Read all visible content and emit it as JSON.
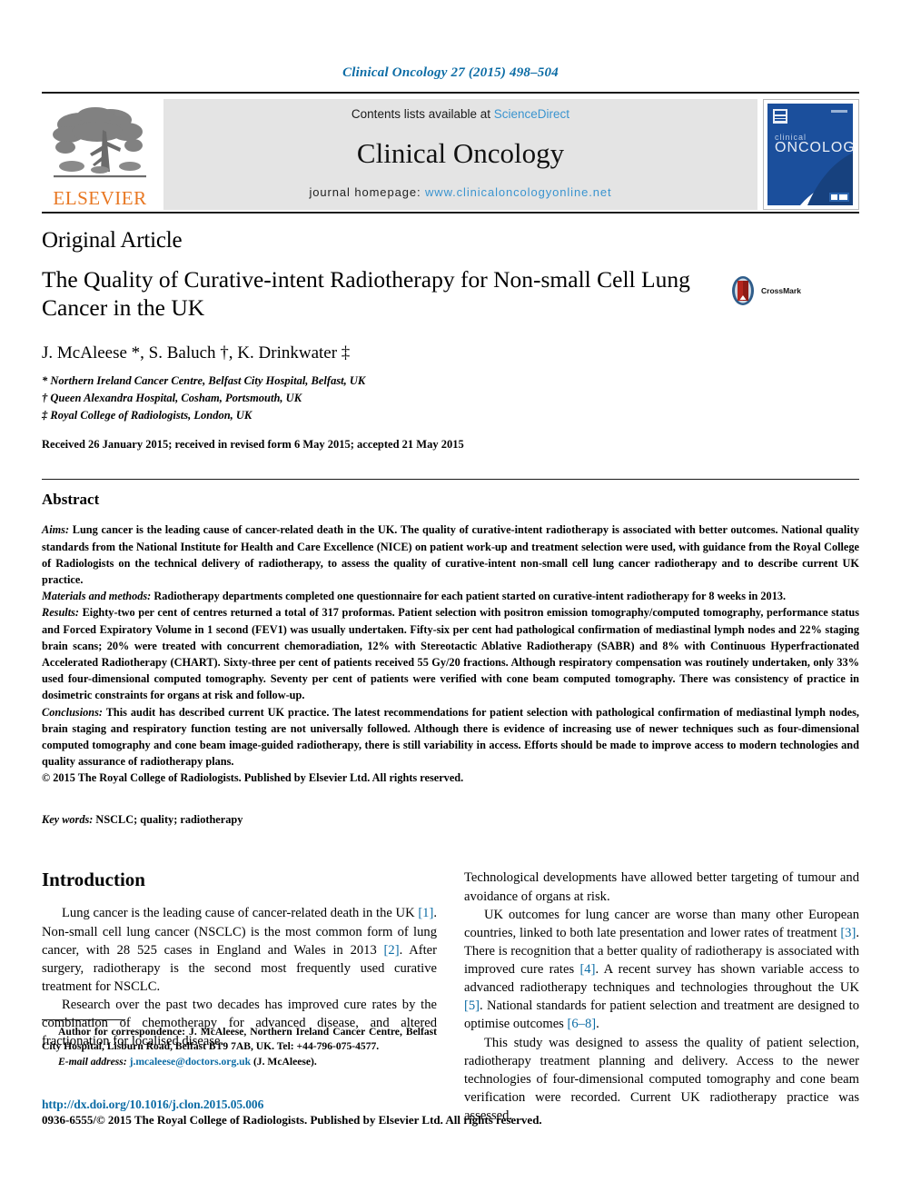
{
  "running_head": "Clinical Oncology 27 (2015) 498–504",
  "masthead": {
    "publisher_logo_word": "ELSEVIER",
    "contents_prefix": "Contents lists available at",
    "contents_link": "ScienceDirect",
    "journal_name": "Clinical Oncology",
    "homepage_prefix": "journal homepage:",
    "homepage_url": "www.clinicaloncologyonline.net",
    "cover_title_small": "clinical",
    "cover_title_large": "ONCOLOGY"
  },
  "article": {
    "type": "Original Article",
    "title": "The Quality of Curative-intent Radiotherapy for Non-small Cell Lung Cancer in the UK",
    "crossmark_label": "CrossMark",
    "authors": "J. McAleese *, S. Baluch †, K. Drinkwater ‡",
    "affiliations": [
      "* Northern Ireland Cancer Centre, Belfast City Hospital, Belfast, UK",
      "† Queen Alexandra Hospital, Cosham, Portsmouth, UK",
      "‡ Royal College of Radiologists, London, UK"
    ],
    "history": "Received 26 January 2015; received in revised form 6 May 2015; accepted 21 May 2015"
  },
  "abstract": {
    "heading": "Abstract",
    "aims_label": "Aims:",
    "aims_text": " Lung cancer is the leading cause of cancer-related death in the UK. The quality of curative-intent radiotherapy is associated with better outcomes. National quality standards from the National Institute for Health and Care Excellence (NICE) on patient work-up and treatment selection were used, with guidance from the Royal College of Radiologists on the technical delivery of radiotherapy, to assess the quality of curative-intent non-small cell lung cancer radiotherapy and to describe current UK practice.",
    "materials_label": "Materials and methods:",
    "materials_text": " Radiotherapy departments completed one questionnaire for each patient started on curative-intent radiotherapy for 8 weeks in 2013.",
    "results_label": "Results:",
    "results_text": " Eighty-two per cent of centres returned a total of 317 proformas. Patient selection with positron emission tomography/computed tomography, performance status and Forced Expiratory Volume in 1 second (FEV1) was usually undertaken. Fifty-six per cent had pathological confirmation of mediastinal lymph nodes and 22% staging brain scans; 20% were treated with concurrent chemoradiation, 12% with Stereotactic Ablative Radiotherapy (SABR) and 8% with Continuous Hyperfractionated Accelerated Radiotherapy (CHART). Sixty-three per cent of patients received 55 Gy/20 fractions. Although respiratory compensation was routinely undertaken, only 33% used four-dimensional computed tomography. Seventy per cent of patients were verified with cone beam computed tomography. There was consistency of practice in dosimetric constraints for organs at risk and follow-up.",
    "conclusions_label": "Conclusions:",
    "conclusions_text": " This audit has described current UK practice. The latest recommendations for patient selection with pathological confirmation of mediastinal lymph nodes, brain staging and respiratory function testing are not universally followed. Although there is evidence of increasing use of newer techniques such as four-dimensional computed tomography and cone beam image-guided radiotherapy, there is still variability in access. Efforts should be made to improve access to modern technologies and quality assurance of radiotherapy plans.",
    "copyright": "© 2015 The Royal College of Radiologists. Published by Elsevier Ltd. All rights reserved.",
    "keywords_label": "Key words:",
    "keywords_text": " NSCLC; quality; radiotherapy"
  },
  "introduction": {
    "heading": "Introduction",
    "left_paragraphs": [
      "Lung cancer is the leading cause of cancer-related death in the UK [1]. Non-small cell lung cancer (NSCLC) is the most common form of lung cancer, with 28 525 cases in England and Wales in 2013 [2]. After surgery, radiotherapy is the second most frequently used curative treatment for NSCLC.",
      "Research over the past two decades has improved cure rates by the combination of chemotherapy for advanced disease, and altered fractionation for localised disease."
    ],
    "right_paragraphs": [
      "Technological developments have allowed better targeting of tumour and avoidance of organs at risk.",
      "UK outcomes for lung cancer are worse than many other European countries, linked to both late presentation and lower rates of treatment [3]. There is recognition that a better quality of radiotherapy is associated with improved cure rates [4]. A recent survey has shown variable access to advanced radiotherapy techniques and technologies throughout the UK [5]. National standards for patient selection and treatment are designed to optimise outcomes [6–8].",
      "This study was designed to assess the quality of patient selection, radiotherapy treatment planning and delivery. Access to the newer technologies of four-dimensional computed tomography and cone beam verification were recorded. Current UK radiotherapy practice was assessed."
    ]
  },
  "footnote": {
    "correspondence_label": "Author for correspondence:",
    "correspondence_text": " J. McAleese, Northern Ireland Cancer Centre, Belfast City Hospital, Lisburn Road, Belfast BT9 7AB, UK. Tel: +44-796-075-4577.",
    "email_label": "E-mail address:",
    "email_address": "j.mcaleese@doctors.org.uk",
    "email_suffix": " (J. McAleese)."
  },
  "footer": {
    "doi": "http://dx.doi.org/10.1016/j.clon.2015.05.006",
    "copyright": "0936-6555/© 2015 The Royal College of Radiologists. Published by Elsevier Ltd. All rights reserved."
  },
  "colors": {
    "link_blue": "#0c6ca5",
    "sd_blue": "#3a94cf",
    "elsevier_orange": "#e87722",
    "cover_blue": "#1b4f9c",
    "crossmark_red": "#b5261e"
  }
}
